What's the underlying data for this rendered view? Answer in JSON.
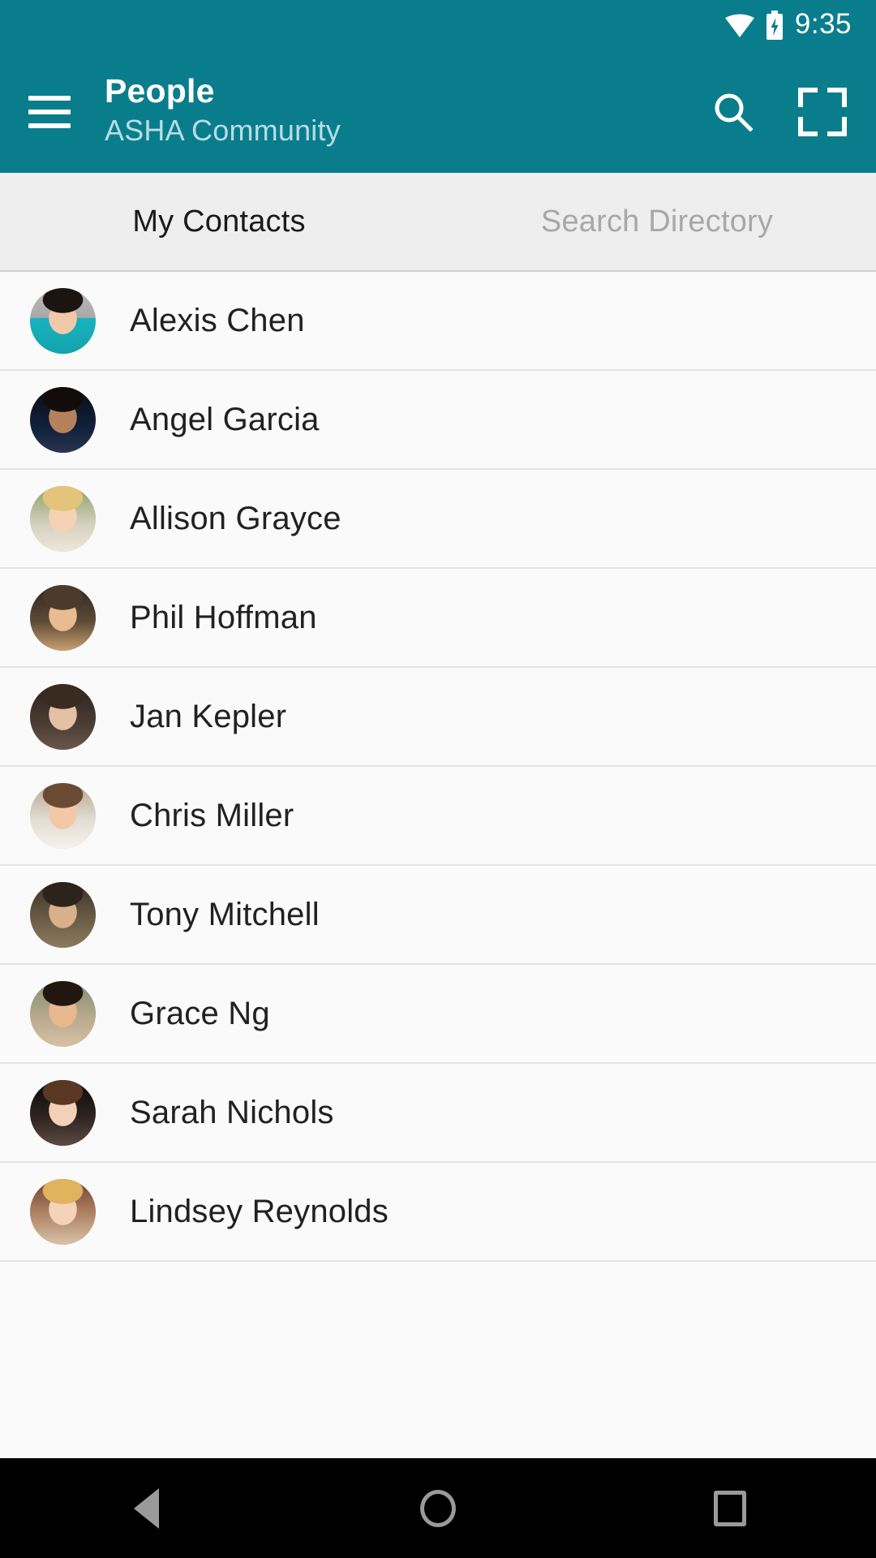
{
  "status_bar": {
    "time": "9:35",
    "wifi_icon": "wifi-icon",
    "battery_icon": "battery-charging-icon"
  },
  "app_bar": {
    "menu_icon": "hamburger-menu-icon",
    "title": "People",
    "subtitle": "ASHA Community",
    "search_icon": "search-icon",
    "grid_icon": "grid-scan-icon",
    "background_color": "#0a7d8c"
  },
  "tabs": [
    {
      "label": "My Contacts",
      "active": true
    },
    {
      "label": "Search Directory",
      "active": false
    }
  ],
  "contacts": [
    {
      "name": "Alexis Chen"
    },
    {
      "name": "Angel Garcia"
    },
    {
      "name": "Allison Grayce"
    },
    {
      "name": "Phil Hoffman"
    },
    {
      "name": "Jan Kepler"
    },
    {
      "name": "Chris Miller"
    },
    {
      "name": "Tony Mitchell"
    },
    {
      "name": "Grace Ng"
    },
    {
      "name": "Sarah Nichols"
    },
    {
      "name": "Lindsey Reynolds"
    }
  ],
  "nav_bar": {
    "back_label": "Back",
    "home_label": "Home",
    "recents_label": "Recent apps"
  }
}
